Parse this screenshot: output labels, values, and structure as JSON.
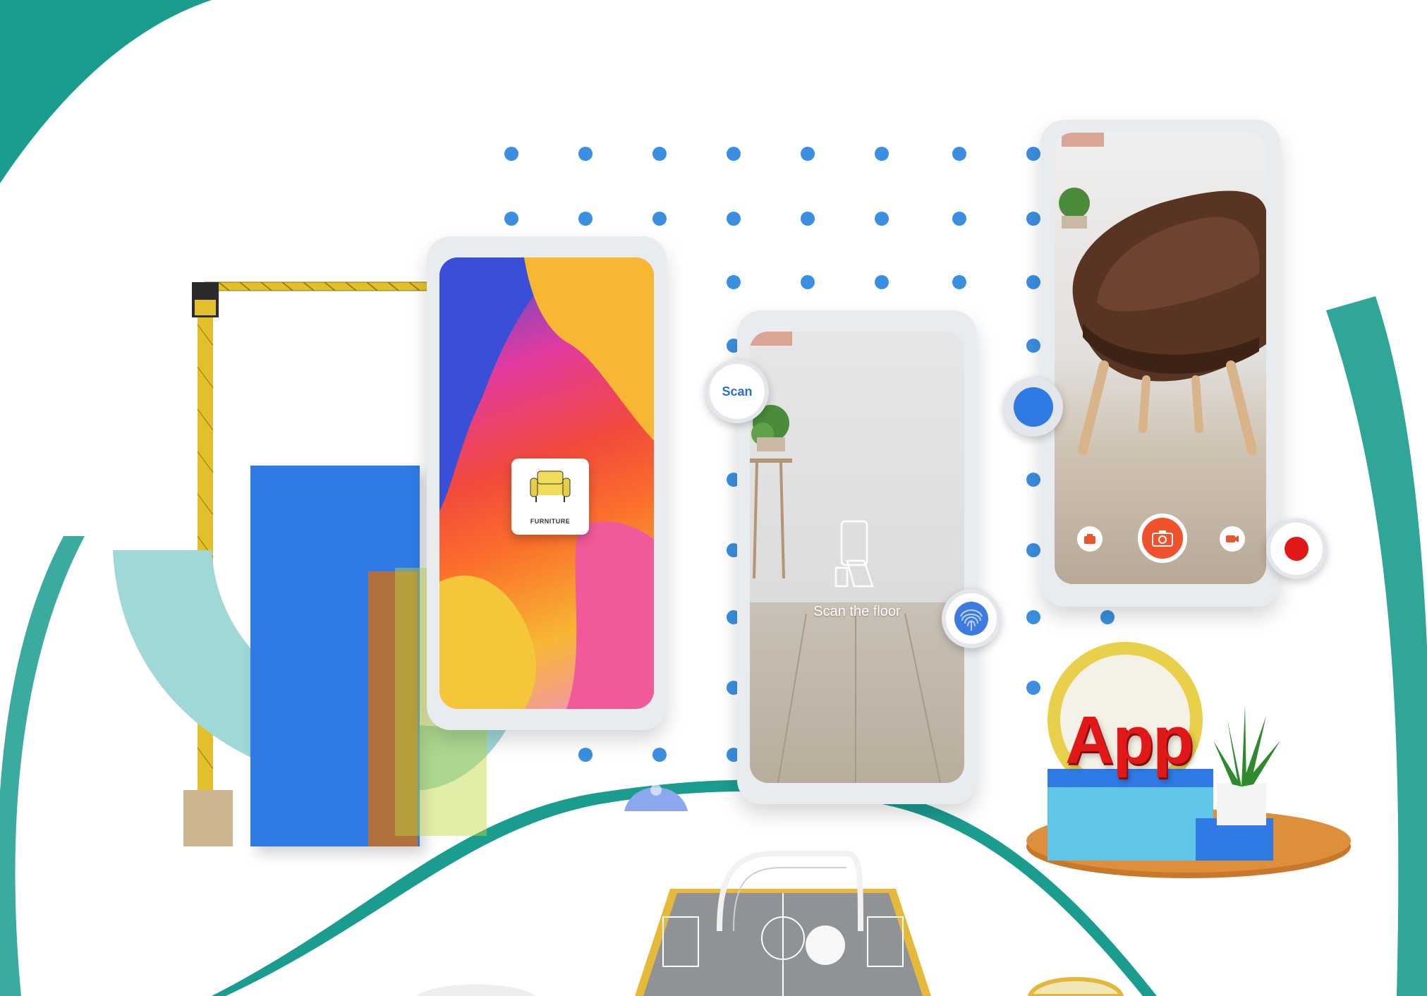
{
  "colors": {
    "teal": "#1a9c8e",
    "blue_bar": "#2f7ae5",
    "dot_blue": "#3a8fe0",
    "record_red": "#e01818",
    "capture_orange": "#f0522e"
  },
  "phone_furniture": {
    "card_label": "FURNITURE",
    "icon": "armchair-icon"
  },
  "phone_scan": {
    "scan_button_label": "Scan",
    "floor_text": "Scan the floor",
    "icons": [
      "phone-scan-icon",
      "fingerprint-icon"
    ]
  },
  "phone_chair": {
    "controls": [
      "camera-small-icon",
      "camera-capture-icon",
      "video-icon",
      "record-icon"
    ]
  },
  "app_label": "App"
}
